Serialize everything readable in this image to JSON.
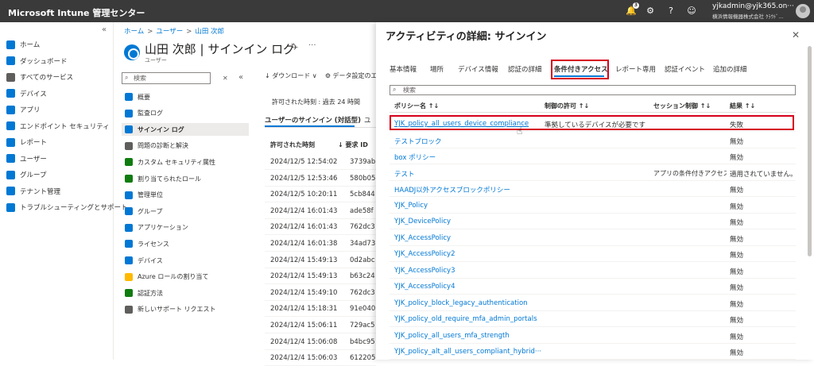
{
  "header": {
    "title": "Microsoft Intune 管理センター",
    "notification_count": "3",
    "account_name": "yjkadmin@yjk365.on···",
    "account_org": "横浜情報機器株式会社  ｸﾗｳﾄﾞ..."
  },
  "leftnav": {
    "collapse": "«",
    "items": [
      {
        "label": "ホーム",
        "icon": "home-icon",
        "color": "#0078d4"
      },
      {
        "label": "ダッシュボード",
        "icon": "dashboard-icon",
        "color": "#0078d4"
      },
      {
        "label": "すべてのサービス",
        "icon": "list-icon",
        "color": "#605e5c"
      },
      {
        "label": "デバイス",
        "icon": "device-icon",
        "color": "#0078d4"
      },
      {
        "label": "アプリ",
        "icon": "apps-icon",
        "color": "#0078d4"
      },
      {
        "label": "エンドポイント セキュリティ",
        "icon": "shield-icon",
        "color": "#0078d4"
      },
      {
        "label": "レポート",
        "icon": "report-icon",
        "color": "#0078d4"
      },
      {
        "label": "ユーザー",
        "icon": "user-icon",
        "color": "#0078d4"
      },
      {
        "label": "グループ",
        "icon": "group-icon",
        "color": "#0078d4"
      },
      {
        "label": "テナント管理",
        "icon": "tenant-icon",
        "color": "#0078d4"
      },
      {
        "label": "トラブルシューティングとサポート",
        "icon": "wrench-icon",
        "color": "#0078d4"
      }
    ]
  },
  "breadcrumb": {
    "items": [
      "ホーム",
      "ユーザー",
      "山田 次郎"
    ],
    "sep": ">"
  },
  "page": {
    "title": "山田 次郎 | サインイン ログ",
    "subtitle": "ユーザー",
    "pin": "✈",
    "more": "···"
  },
  "menu": {
    "search_placeholder": "検索",
    "clear": "✕",
    "collapse": "«",
    "items": [
      {
        "label": "概要",
        "color": "#0078d4"
      },
      {
        "label": "監査ログ",
        "color": "#0078d4"
      },
      {
        "label": "サインイン ログ",
        "color": "#0078d4"
      },
      {
        "label": "問題の診断と解決",
        "color": "#605e5c"
      },
      {
        "label": "カスタム セキュリティ属性",
        "color": "#107c10"
      },
      {
        "label": "割り当てられたロール",
        "color": "#107c10"
      },
      {
        "label": "管理単位",
        "color": "#0078d4"
      },
      {
        "label": "グループ",
        "color": "#0078d4"
      },
      {
        "label": "アプリケーション",
        "color": "#0078d4"
      },
      {
        "label": "ライセンス",
        "color": "#0078d4"
      },
      {
        "label": "デバイス",
        "color": "#0078d4"
      },
      {
        "label": "Azure ロールの割り当て",
        "color": "#ffb900"
      },
      {
        "label": "認証方法",
        "color": "#107c10"
      },
      {
        "label": "新しいサポート リクエスト",
        "color": "#605e5c"
      }
    ]
  },
  "list": {
    "toolbar_download": "↓ ダウンロード ∨",
    "toolbar_settings": "⚙ データ設定のエ",
    "range_label": "許可された時刻 : 過去 24 時間",
    "tab_active": "ユーザーのサインイン (対話型)",
    "tab_next": "ユ",
    "col_time": "許可された時刻",
    "col_req": "↓  要求 ID",
    "rows": [
      {
        "time": "2024/12/5 12:54:02",
        "req": "3739ab"
      },
      {
        "time": "2024/12/5 12:53:46",
        "req": "580b05"
      },
      {
        "time": "2024/12/5 10:20:11",
        "req": "5cb844"
      },
      {
        "time": "2024/12/4 16:01:43",
        "req": "ade58f"
      },
      {
        "time": "2024/12/4 16:01:43",
        "req": "762dc3"
      },
      {
        "time": "2024/12/4 16:01:38",
        "req": "34ad73"
      },
      {
        "time": "2024/12/4 15:49:13",
        "req": "0d2abc"
      },
      {
        "time": "2024/12/4 15:49:13",
        "req": "b63c24"
      },
      {
        "time": "2024/12/4 15:49:10",
        "req": "762dc3"
      },
      {
        "time": "2024/12/4 15:18:31",
        "req": "91e040"
      },
      {
        "time": "2024/12/4 15:06:11",
        "req": "729ac5"
      },
      {
        "time": "2024/12/4 15:06:08",
        "req": "b4bc95"
      },
      {
        "time": "2024/12/4 15:06:03",
        "req": "612205"
      }
    ]
  },
  "panel": {
    "title": "アクティビティの詳細: サインイン",
    "close": "✕",
    "tabs": [
      "基本情報",
      "場所",
      "デバイス情報",
      "認証の詳細",
      "条件付きアクセス",
      "レポート専用",
      "認証イベント",
      "追加の詳細"
    ],
    "search_placeholder": "検索",
    "headers": {
      "name": "ポリシー名  ↑↓",
      "grant": "制御の許可  ↑↓",
      "session": "セッション制御  ↑↓",
      "result": "結果  ↑↓"
    },
    "rows": [
      {
        "name": "YJK_policy_all_users_device_compliance",
        "grant": "準拠しているデバイスが必要です",
        "session": "",
        "result": "失敗"
      },
      {
        "name": "テストブロック",
        "grant": "",
        "session": "",
        "result": "無効"
      },
      {
        "name": "box ポリシー",
        "grant": "",
        "session": "",
        "result": "無効"
      },
      {
        "name": "テスト",
        "grant": "",
        "session": "アプリの条件付きアクセス...",
        "result": "適用されていません。"
      },
      {
        "name": "HAADJ以外アクセスブロックポリシー",
        "grant": "",
        "session": "",
        "result": "無効"
      },
      {
        "name": "YJK_Policy",
        "grant": "",
        "session": "",
        "result": "無効"
      },
      {
        "name": "YJK_DevicePolicy",
        "grant": "",
        "session": "",
        "result": "無効"
      },
      {
        "name": "YJK_AccessPolicy",
        "grant": "",
        "session": "",
        "result": "無効"
      },
      {
        "name": "YJK_AccessPolicy2",
        "grant": "",
        "session": "",
        "result": "無効"
      },
      {
        "name": "YJK_AccessPolicy3",
        "grant": "",
        "session": "",
        "result": "無効"
      },
      {
        "name": "YJK_AccessPolicy4",
        "grant": "",
        "session": "",
        "result": "無効"
      },
      {
        "name": "YJK_policy_block_legacy_authentication",
        "grant": "",
        "session": "",
        "result": "無効"
      },
      {
        "name": "YJK_policy_old_require_mfa_admin_portals",
        "grant": "",
        "session": "",
        "result": "無効"
      },
      {
        "name": "YJK_policy_all_users_mfa_strength",
        "grant": "",
        "session": "",
        "result": "無効"
      },
      {
        "name": "YJK_policy_alt_all_users_compliant_hybrid···",
        "grant": "",
        "session": "",
        "result": "無効"
      }
    ]
  }
}
